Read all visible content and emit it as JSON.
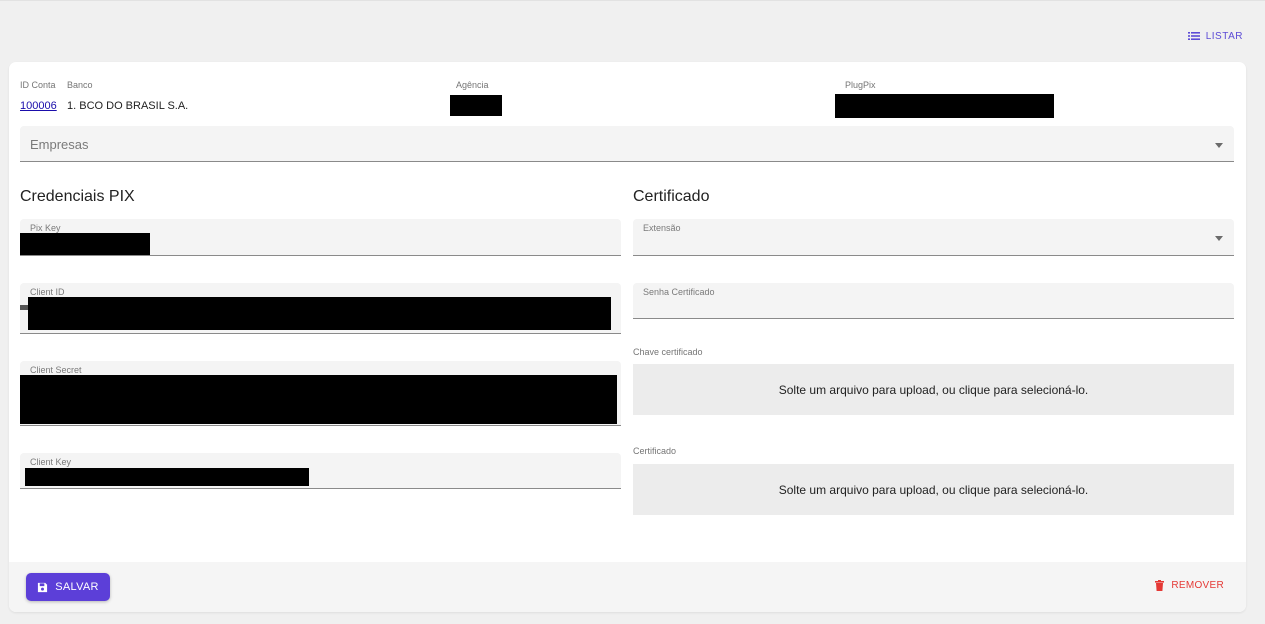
{
  "header": {
    "listar_label": "LISTAR"
  },
  "account": {
    "id_conta_label": "ID Conta",
    "id_conta_value": "100006",
    "banco_label": "Banco",
    "banco_value": "1. BCO DO BRASIL S.A.",
    "agencia_label": "Agência",
    "plugpix_label": "PlugPix"
  },
  "empresas": {
    "placeholder": "Empresas"
  },
  "credenciais": {
    "title": "Credenciais PIX",
    "pix_key_label": "Pix Key",
    "client_id_label": "Client ID",
    "client_secret_label": "Client Secret",
    "client_key_label": "Client Key"
  },
  "certificado": {
    "title": "Certificado",
    "extensao_label": "Extensão",
    "senha_label": "Senha Certificado",
    "chave_label": "Chave certificado",
    "chave_dropzone": "Solte um arquivo para upload, ou clique para selecioná-lo.",
    "cert_label": "Certificado",
    "cert_dropzone": "Solte um arquivo para upload, ou clique para selecioná-lo."
  },
  "footer": {
    "salvar_label": "SALVAR",
    "remover_label": "REMOVER"
  },
  "colors": {
    "accent": "#5c3fd8",
    "danger": "#e53935",
    "link": "#1a0dab"
  }
}
